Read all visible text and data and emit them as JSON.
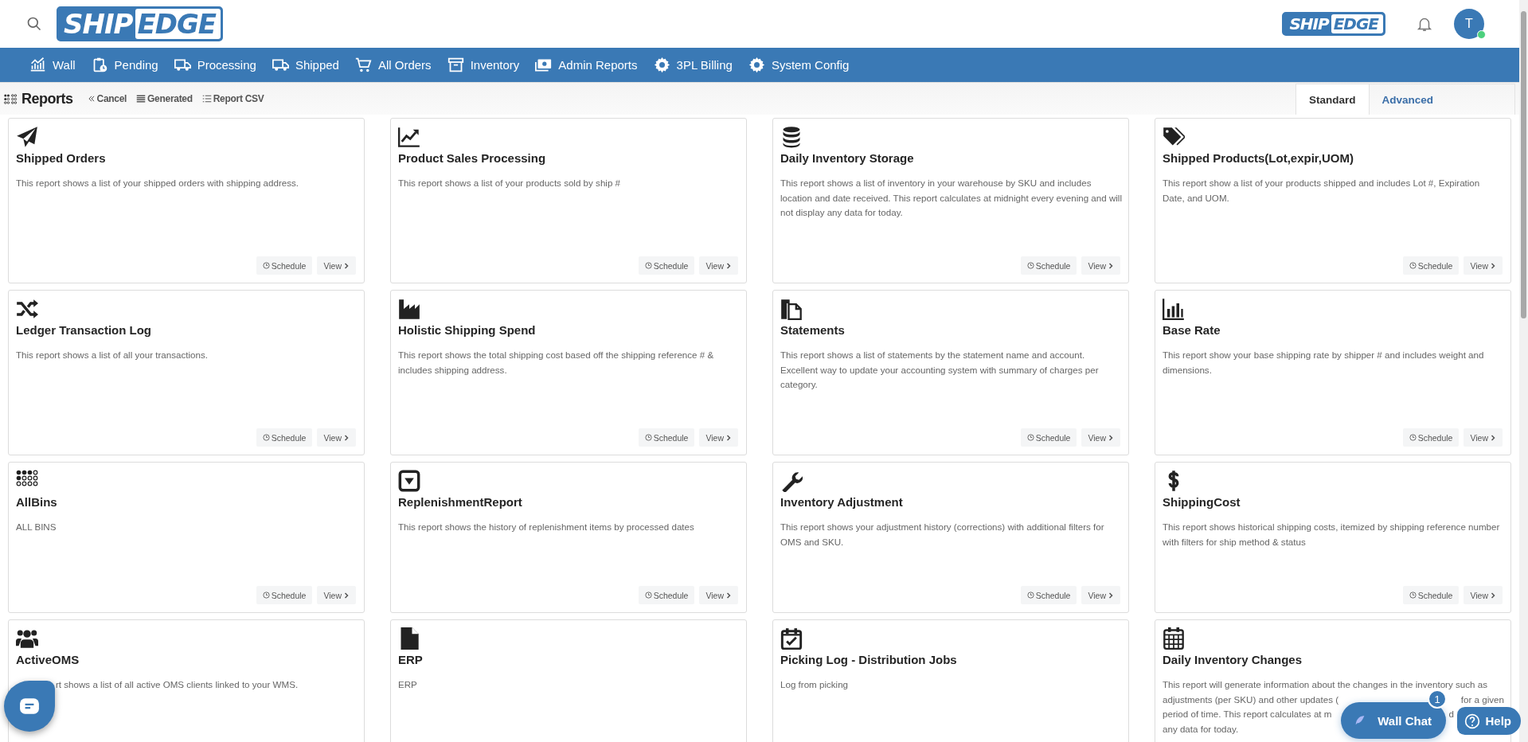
{
  "header": {
    "logo": [
      "SHIP",
      "EDGE"
    ],
    "brand_logo": [
      "SHIP",
      "EDGE"
    ],
    "avatar": "T",
    "online": true
  },
  "nav": [
    "Wall",
    "Pending",
    "Processing",
    "Shipped",
    "All Orders",
    "Inventory",
    "Admin Reports",
    "3PL Billing",
    "System Config"
  ],
  "toolbar": {
    "title": "Reports",
    "actions": [
      "Cancel",
      "Generated",
      "Report CSV"
    ]
  },
  "tabs": [
    {
      "label": "Standard",
      "selected": true
    },
    {
      "label": "Advanced",
      "selected": false
    }
  ],
  "reports": [
    {
      "title": "Shipped Orders",
      "description": "This report shows a list of your shipped orders with shipping address.",
      "schedule": "Schedule",
      "view": "View"
    },
    {
      "title": "Product Sales Processing",
      "description": "This report shows a list of your products sold by ship #",
      "schedule": "Schedule",
      "view": "View"
    },
    {
      "title": "Daily Inventory Storage",
      "description": "This report shows a list of inventory in your warehouse by SKU and includes location and date received. This report calculates at midnight every evening and will not display any data for today.",
      "schedule": "Schedule",
      "view": "View"
    },
    {
      "title": "Shipped Products(Lot,expir,UOM)",
      "description": "This report show a list of your products shipped and includes Lot #, Expiration Date, and UOM.",
      "schedule": "Schedule",
      "view": "View"
    },
    {
      "title": "Ledger Transaction Log",
      "description": "This report shows a list of all your transactions.",
      "schedule": "Schedule",
      "view": "View"
    },
    {
      "title": "Holistic Shipping Spend",
      "description": "This report shows the total shipping cost based off the shipping reference # & includes shipping address.",
      "schedule": "Schedule",
      "view": "View"
    },
    {
      "title": "Statements",
      "description": "This report shows a list of statements by the statement name and account. Excellent way to update your accounting system with summary of charges per category.",
      "schedule": "Schedule",
      "view": "View"
    },
    {
      "title": "Base Rate",
      "description": "This report show your base shipping rate by shipper # and includes weight and dimensions.",
      "schedule": "Schedule",
      "view": "View"
    },
    {
      "title": "AllBins",
      "description": "ALL BINS",
      "schedule": "Schedule",
      "view": "View"
    },
    {
      "title": "ReplenishmentReport",
      "description": "This report shows the history of replenishment items by processed dates",
      "schedule": "Schedule",
      "view": "View"
    },
    {
      "title": "Inventory Adjustment",
      "description": "This report shows your adjustment history (corrections) with additional filters for OMS and SKU.",
      "schedule": "Schedule",
      "view": "View"
    },
    {
      "title": "ShippingCost",
      "description": "This report shows historical shipping costs, itemized by shipping reference number with filters for ship method & status",
      "schedule": "Schedule",
      "view": "View"
    },
    {
      "title": "ActiveOMS",
      "description_lines": [
        {
          "text": "rt shows a list of all active OMS clients linked to your WMS.",
          "covered_start": true
        }
      ]
    },
    {
      "title": "ERP",
      "description": "ERP"
    },
    {
      "title": "Picking Log - Distribution Jobs",
      "description": "Log from picking"
    },
    {
      "title": "Daily Inventory Changes",
      "description_lines": [
        {
          "text": "This report will generate information about the changes in the inventory such as"
        },
        {
          "text": "adjustments (per SKU) and other updates (",
          "tail": "for a given"
        },
        {
          "text": "period of time. This report calculates at m",
          "tail": "d"
        },
        {
          "text": "any data for today."
        }
      ]
    }
  ],
  "wall_chat": {
    "label": "Wall Chat",
    "badge": "1"
  },
  "help": "Help"
}
